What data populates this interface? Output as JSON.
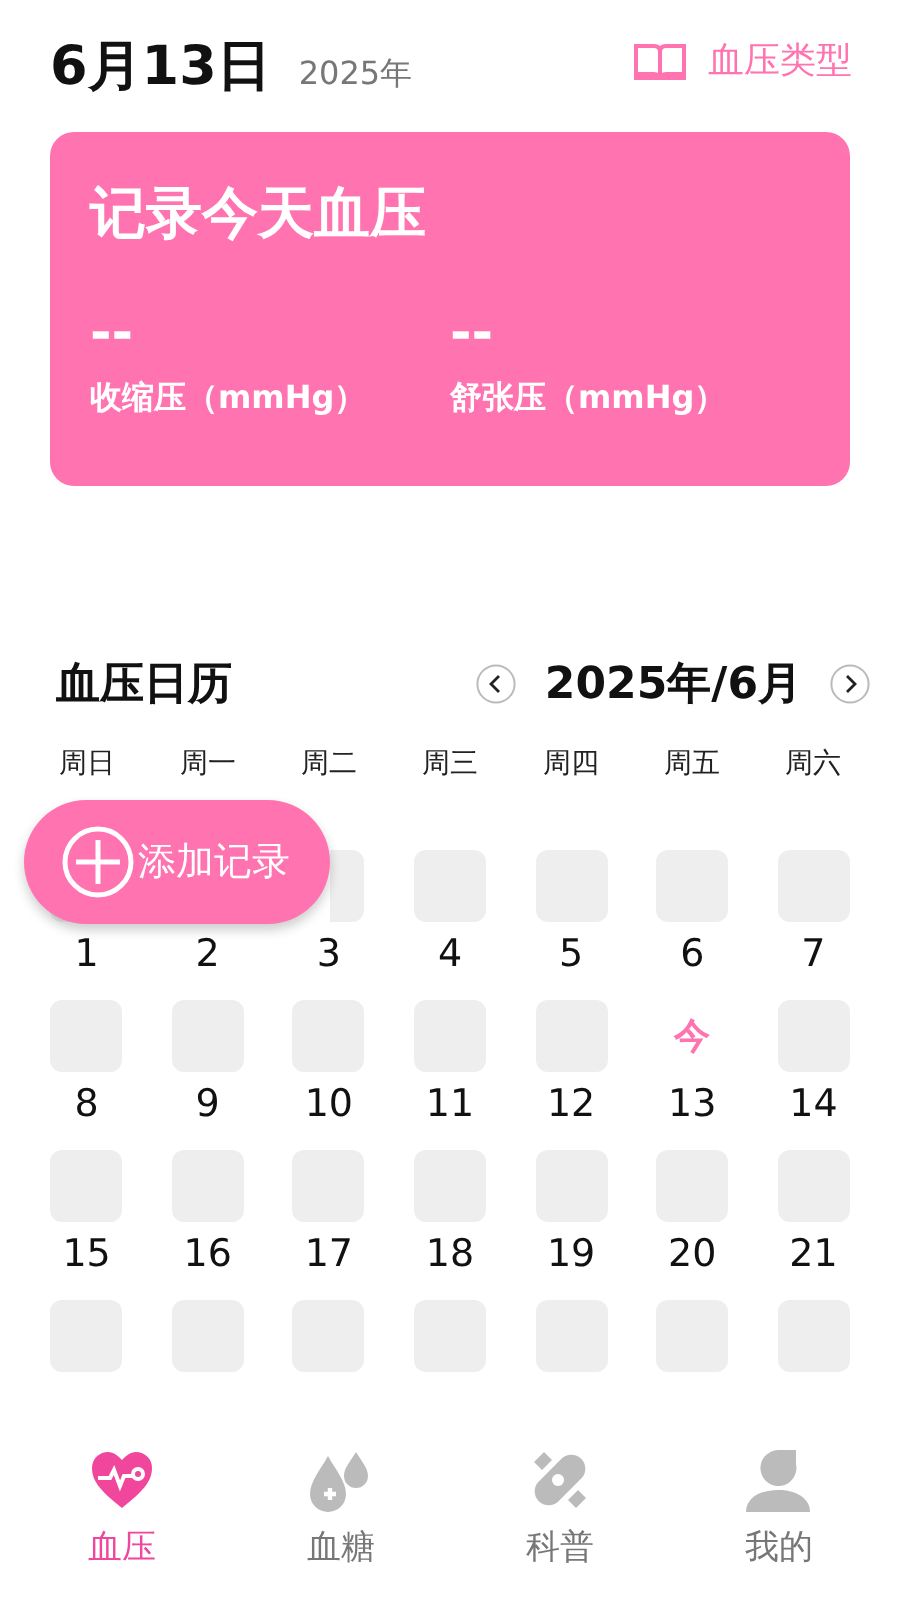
{
  "header": {
    "date": "6月13日",
    "year": "2025年",
    "link": "血压类型"
  },
  "card": {
    "title": "记录今天血压",
    "readings": [
      {
        "value": "--",
        "label": "收缩压（mmHg）"
      },
      {
        "value": "--",
        "label": "舒张压（mmHg）"
      }
    ]
  },
  "calendar": {
    "title": "血压日历",
    "month": "2025年/6月",
    "weekdays": [
      "周日",
      "周一",
      "周二",
      "周三",
      "周四",
      "周五",
      "周六"
    ],
    "days": [
      {
        "kind": "day",
        "label": "1"
      },
      {
        "kind": "day",
        "label": "2"
      },
      {
        "kind": "day",
        "label": "3"
      },
      {
        "kind": "day",
        "label": "4"
      },
      {
        "kind": "day",
        "label": "5"
      },
      {
        "kind": "day",
        "label": "6"
      },
      {
        "kind": "day",
        "label": "7"
      },
      {
        "kind": "day",
        "label": "8"
      },
      {
        "kind": "day",
        "label": "9"
      },
      {
        "kind": "day",
        "label": "10"
      },
      {
        "kind": "day",
        "label": "11"
      },
      {
        "kind": "day",
        "label": "12"
      },
      {
        "kind": "today",
        "label": "13",
        "mark": "今"
      },
      {
        "kind": "day",
        "label": "14"
      },
      {
        "kind": "day",
        "label": "15"
      },
      {
        "kind": "day",
        "label": "16"
      },
      {
        "kind": "day",
        "label": "17"
      },
      {
        "kind": "day",
        "label": "18"
      },
      {
        "kind": "day",
        "label": "19"
      },
      {
        "kind": "day",
        "label": "20"
      },
      {
        "kind": "day",
        "label": "21"
      },
      {
        "kind": "cut"
      },
      {
        "kind": "cut"
      },
      {
        "kind": "cut"
      },
      {
        "kind": "cut"
      },
      {
        "kind": "cut"
      },
      {
        "kind": "cut"
      },
      {
        "kind": "cut"
      }
    ]
  },
  "add_button": {
    "label": "添加记录"
  },
  "tabs": [
    {
      "label": "血压",
      "selected": true,
      "kind": "heart"
    },
    {
      "label": "血糖",
      "selected": false,
      "kind": "drops"
    },
    {
      "label": "科普",
      "selected": false,
      "kind": "capsule"
    },
    {
      "label": "我的",
      "selected": false,
      "kind": "person"
    }
  ]
}
